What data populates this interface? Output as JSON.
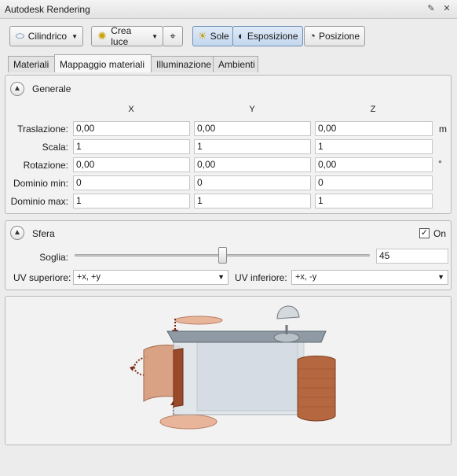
{
  "window": {
    "title": "Autodesk Rendering"
  },
  "toolbar": {
    "cilindrico_label": "Cilindrico",
    "crea_luce_label": "Crea luce",
    "sole_label": "Sole",
    "esposizione_label": "Esposizione",
    "posizione_label": "Posizione"
  },
  "tabs": [
    {
      "label": "Materiali"
    },
    {
      "label": "Mappaggio materiali"
    },
    {
      "label": "Illuminazione"
    },
    {
      "label": "Ambienti"
    }
  ],
  "generale": {
    "title": "Generale",
    "axes": [
      "X",
      "Y",
      "Z"
    ],
    "rows": [
      {
        "label": "Traslazione:",
        "values": [
          "0,00",
          "0,00",
          "0,00"
        ],
        "unit": "m"
      },
      {
        "label": "Scala:",
        "values": [
          "1",
          "1",
          "1"
        ],
        "unit": ""
      },
      {
        "label": "Rotazione:",
        "values": [
          "0,00",
          "0,00",
          "0,00"
        ],
        "unit": "°"
      },
      {
        "label": "Dominio min:",
        "values": [
          "0",
          "0",
          "0"
        ],
        "unit": ""
      },
      {
        "label": "Dominio max:",
        "values": [
          "1",
          "1",
          "1"
        ],
        "unit": ""
      }
    ]
  },
  "sfera": {
    "title": "Sfera",
    "on_label": "On",
    "on_checked": "✓",
    "soglia_label": "Soglia:",
    "soglia_value": "45",
    "soglia_fraction": 0.5,
    "uv_sup_label": "UV superiore:",
    "uv_sup_value": "+x, +y",
    "uv_inf_label": "UV inferiore:",
    "uv_inf_value": "+x, -y"
  },
  "colors": {
    "accent": "#c4d7ee",
    "brick": "#b5673f"
  }
}
